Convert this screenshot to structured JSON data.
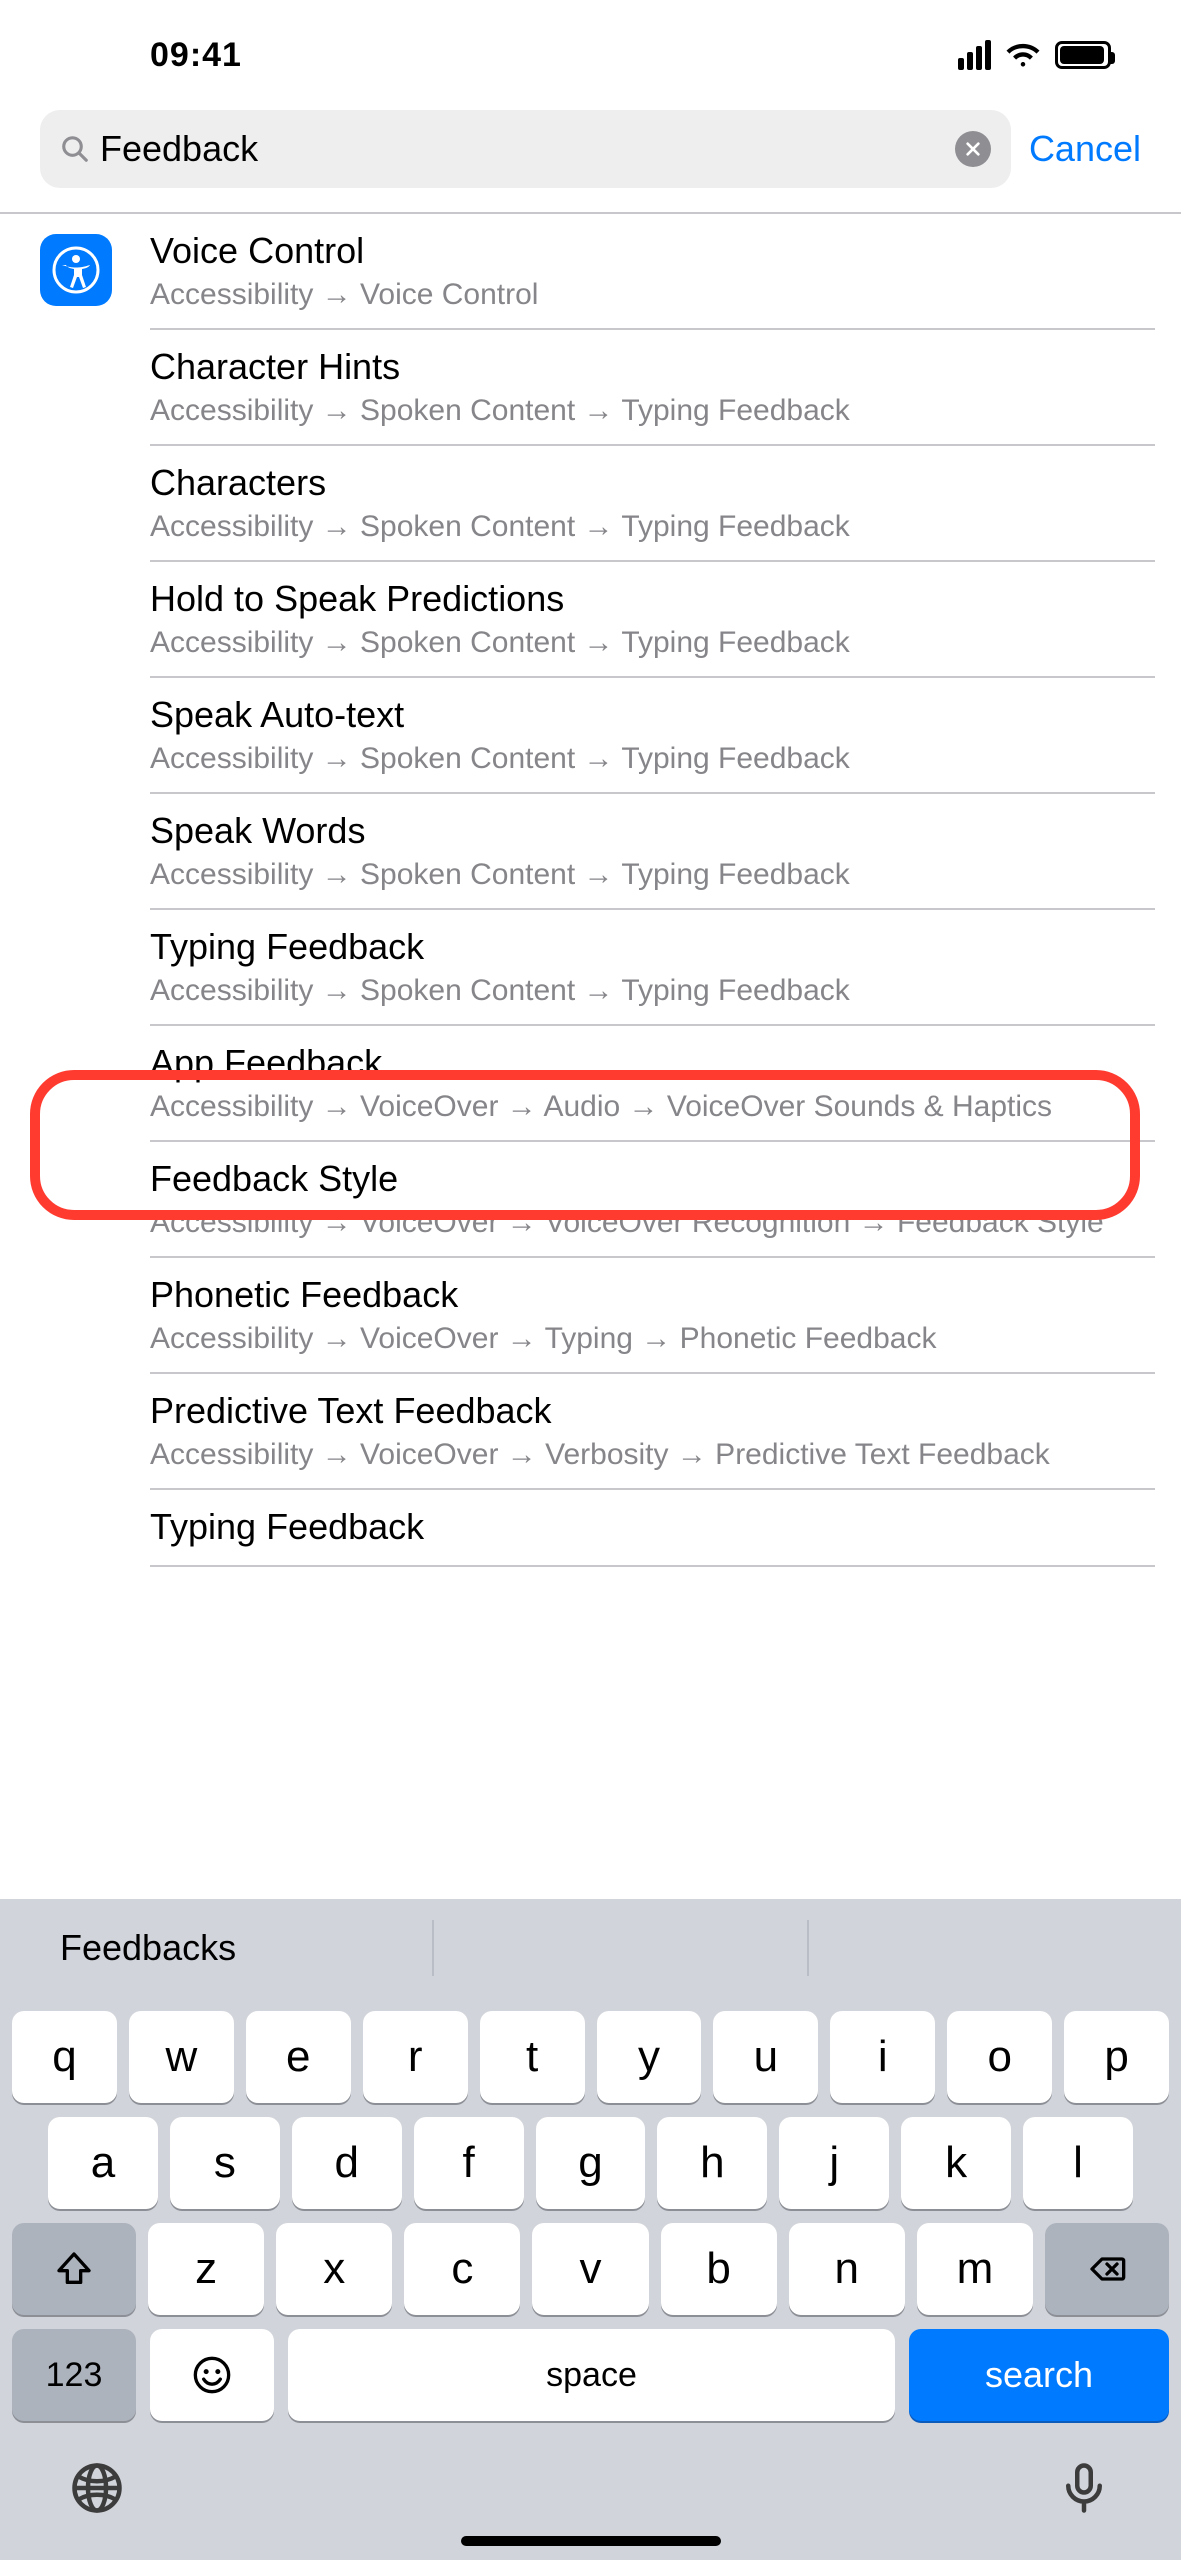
{
  "status": {
    "time": "09:41"
  },
  "search": {
    "value": "Feedback",
    "cancel": "Cancel"
  },
  "results": [
    {
      "title": "Voice Control",
      "path": "Accessibility → Voice Control"
    },
    {
      "title": "Character Hints",
      "path": "Accessibility → Spoken Content → Typing Feedback"
    },
    {
      "title": "Characters",
      "path": "Accessibility → Spoken Content → Typing Feedback"
    },
    {
      "title": "Hold to Speak Predictions",
      "path": "Accessibility → Spoken Content → Typing Feedback"
    },
    {
      "title": "Speak Auto-text",
      "path": "Accessibility → Spoken Content → Typing Feedback"
    },
    {
      "title": "Speak Words",
      "path": "Accessibility → Spoken Content → Typing Feedback"
    },
    {
      "title": "Typing Feedback",
      "path": "Accessibility → Spoken Content → Typing Feedback"
    },
    {
      "title": "App Feedback",
      "path": "Accessibility → VoiceOver → Audio → VoiceOver Sounds & Haptics"
    },
    {
      "title": "Feedback Style",
      "path": "Accessibility → VoiceOver → VoiceOver Recognition → Feedback Style"
    },
    {
      "title": "Phonetic Feedback",
      "path": "Accessibility → VoiceOver → Typing → Phonetic Feedback"
    },
    {
      "title": "Predictive Text Feedback",
      "path": "Accessibility → VoiceOver → Verbosity → Predictive Text Feedback"
    },
    {
      "title": "Typing Feedback",
      "path": ""
    }
  ],
  "highlight_index": 8,
  "keyboard": {
    "suggestion": "Feedbacks",
    "rows": {
      "r1": [
        "q",
        "w",
        "e",
        "r",
        "t",
        "y",
        "u",
        "i",
        "o",
        "p"
      ],
      "r2": [
        "a",
        "s",
        "d",
        "f",
        "g",
        "h",
        "j",
        "k",
        "l"
      ],
      "r3": [
        "z",
        "x",
        "c",
        "v",
        "b",
        "n",
        "m"
      ]
    },
    "numbers": "123",
    "space": "space",
    "search": "search"
  }
}
